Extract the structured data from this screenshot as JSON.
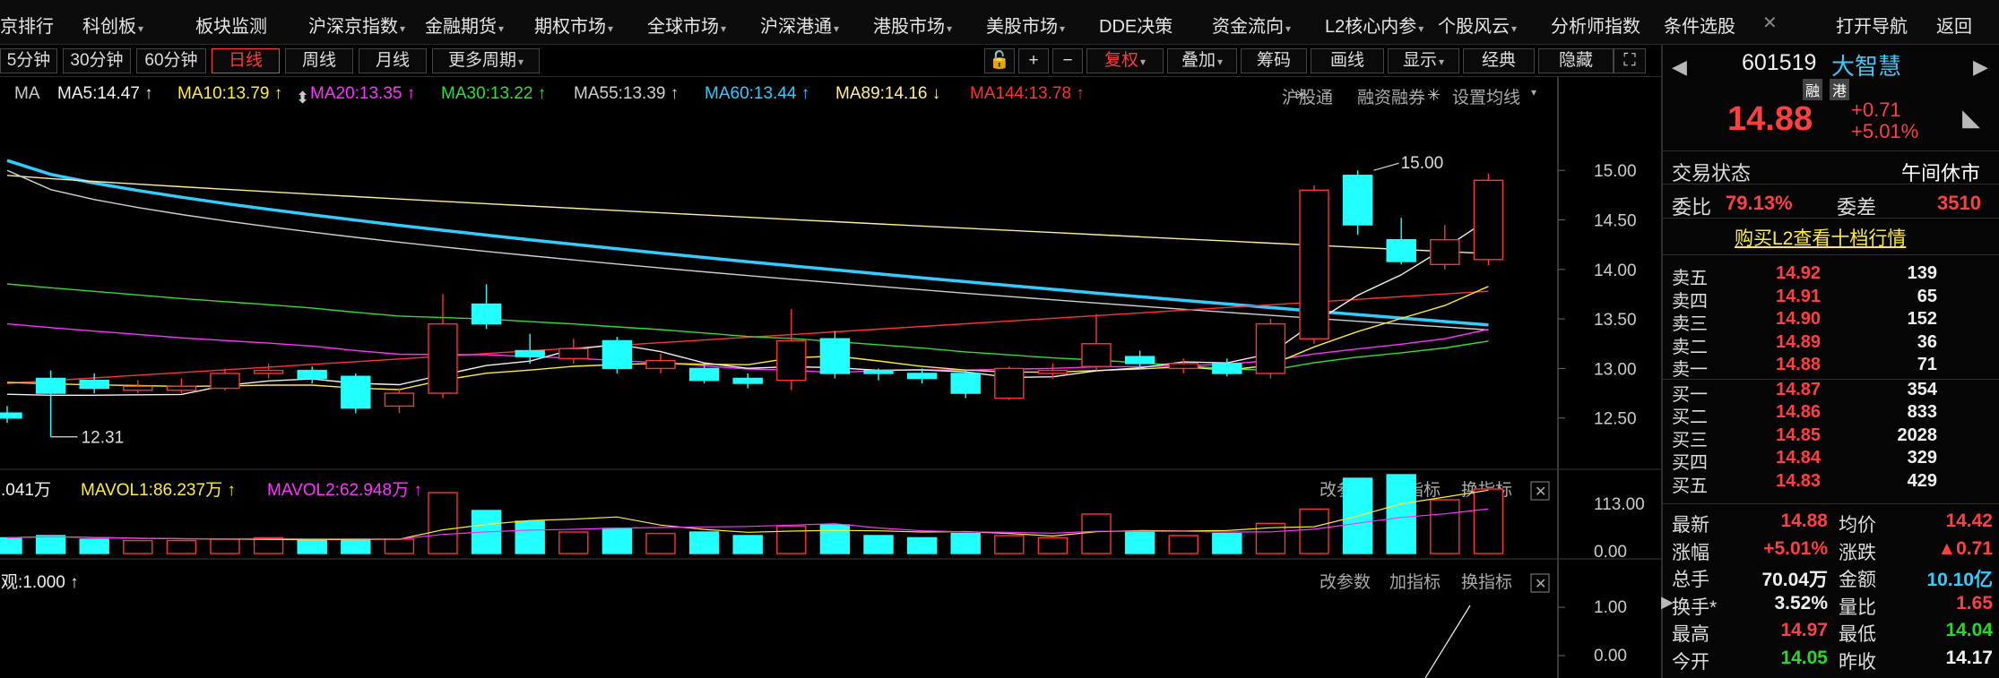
{
  "topnav": {
    "items": [
      "京排行",
      "科创板",
      "板块监测",
      "沪深京指数",
      "金融期货",
      "期权市场",
      "全球市场",
      "沪深港通",
      "港股市场",
      "美股市场",
      "DDE决策",
      "资金流向",
      "L2核心内参",
      "个股风云",
      "分析师指数",
      "条件选股"
    ],
    "right": [
      "打开导航",
      "返回"
    ]
  },
  "toolbar": {
    "periods": [
      "5分钟",
      "30分钟",
      "60分钟",
      "日线",
      "周线",
      "月线",
      "更多周期"
    ],
    "active_period": "日线",
    "tools": [
      "复权",
      "叠加",
      "筹码",
      "画线",
      "显示",
      "经典",
      "隐藏"
    ]
  },
  "ma_legend": {
    "ma_label": "MA",
    "ma5": "MA5:14.47",
    "ma10": "MA10:13.79",
    "ma20": "MA20:13.35",
    "ma30": "MA30:13.22",
    "ma55": "MA55:13.39",
    "ma60": "MA60:13.44",
    "ma89": "MA89:14.16",
    "ma144": "MA144:13.78",
    "links": [
      "沪股通",
      "融资融券",
      "设置均线"
    ]
  },
  "colors": {
    "ma5": "#f0f0f0",
    "ma10": "#ffee33",
    "ma20": "#ff33ff",
    "ma30": "#33dd33",
    "ma55": "#d0d0d0",
    "ma60": "#33ccff",
    "ma89": "#ffee99",
    "ma144": "#ff3333",
    "up": "#ff3333",
    "down": "#22ffff"
  },
  "price_axis": [
    "15.00",
    "14.50",
    "14.00",
    "13.50",
    "13.00",
    "12.50"
  ],
  "annotations": {
    "high": "15.00",
    "low": "12.31"
  },
  "volume_panel": {
    "vol_label": ".041万",
    "mavol1": "MAVOL1:86.237万",
    "mavol2": "MAVOL2:62.948万",
    "links": [
      "改参数",
      "加指标",
      "换指标"
    ],
    "axis": [
      "113.00",
      "0.00"
    ]
  },
  "indicator_panel": {
    "label": "观:1.000",
    "links": [
      "改参数",
      "加指标",
      "换指标"
    ],
    "axis": [
      "1.00",
      "0.00"
    ]
  },
  "stock": {
    "code": "601519",
    "name": "大智慧",
    "tags": [
      "融",
      "港"
    ],
    "price": "14.88",
    "change": "+0.71",
    "change_pct": "+5.01%",
    "trade_status_label": "交易状态",
    "trade_status": "午间休市",
    "weibi_label": "委比",
    "weibi": "79.13%",
    "weicha_label": "委差",
    "weicha": "3510",
    "l2_link": "购买L2查看十档行情"
  },
  "orderbook": {
    "asks": [
      {
        "label": "卖五",
        "price": "14.92",
        "vol": "139"
      },
      {
        "label": "卖四",
        "price": "14.91",
        "vol": "65"
      },
      {
        "label": "卖三",
        "price": "14.90",
        "vol": "152"
      },
      {
        "label": "卖二",
        "price": "14.89",
        "vol": "36"
      },
      {
        "label": "卖一",
        "price": "14.88",
        "vol": "71"
      }
    ],
    "bids": [
      {
        "label": "买一",
        "price": "14.87",
        "vol": "354"
      },
      {
        "label": "买二",
        "price": "14.86",
        "vol": "833"
      },
      {
        "label": "买三",
        "price": "14.85",
        "vol": "2028"
      },
      {
        "label": "买四",
        "price": "14.84",
        "vol": "329"
      },
      {
        "label": "买五",
        "price": "14.83",
        "vol": "429"
      }
    ]
  },
  "stats": {
    "left": [
      {
        "label": "最新",
        "value": "14.88",
        "color": "red"
      },
      {
        "label": "涨幅",
        "value": "+5.01%",
        "color": "red"
      },
      {
        "label": "总手",
        "value": "70.04万",
        "color": "white"
      },
      {
        "label": "换手*",
        "value": "3.52%",
        "color": "white"
      },
      {
        "label": "最高",
        "value": "14.97",
        "color": "red"
      },
      {
        "label": "今开",
        "value": "14.05",
        "color": "green"
      }
    ],
    "right": [
      {
        "label": "均价",
        "value": "14.42",
        "color": "red"
      },
      {
        "label": "涨跌",
        "value": "▲0.71",
        "color": "red"
      },
      {
        "label": "金额",
        "value": "10.10亿",
        "color": "cyan"
      },
      {
        "label": "量比",
        "value": "1.65",
        "color": "red"
      },
      {
        "label": "最低",
        "value": "14.04",
        "color": "green"
      },
      {
        "label": "昨收",
        "value": "14.17",
        "color": "white"
      }
    ]
  },
  "chart_data": {
    "type": "candlestick",
    "y_range": [
      12.0,
      15.4
    ],
    "candles": [
      {
        "o": 12.55,
        "c": 12.5,
        "h": 12.62,
        "l": 12.45
      },
      {
        "o": 12.9,
        "c": 12.75,
        "h": 12.98,
        "l": 12.31
      },
      {
        "o": 12.88,
        "c": 12.8,
        "h": 12.95,
        "l": 12.75
      },
      {
        "o": 12.78,
        "c": 12.82,
        "h": 12.88,
        "l": 12.75
      },
      {
        "o": 12.78,
        "c": 12.82,
        "h": 12.9,
        "l": 12.75
      },
      {
        "o": 12.8,
        "c": 12.95,
        "h": 13.0,
        "l": 12.78
      },
      {
        "o": 12.95,
        "c": 12.98,
        "h": 13.05,
        "l": 12.9
      },
      {
        "o": 12.98,
        "c": 12.9,
        "h": 13.02,
        "l": 12.85
      },
      {
        "o": 12.92,
        "c": 12.6,
        "h": 12.95,
        "l": 12.55
      },
      {
        "o": 12.62,
        "c": 12.75,
        "h": 12.8,
        "l": 12.55
      },
      {
        "o": 12.75,
        "c": 13.45,
        "h": 13.75,
        "l": 12.7
      },
      {
        "o": 13.65,
        "c": 13.45,
        "h": 13.85,
        "l": 13.4
      },
      {
        "o": 13.18,
        "c": 13.12,
        "h": 13.35,
        "l": 13.05
      },
      {
        "o": 13.1,
        "c": 13.2,
        "h": 13.3,
        "l": 13.05
      },
      {
        "o": 13.28,
        "c": 13.0,
        "h": 13.32,
        "l": 12.95
      },
      {
        "o": 13.0,
        "c": 13.08,
        "h": 13.15,
        "l": 12.95
      },
      {
        "o": 13.0,
        "c": 12.88,
        "h": 13.05,
        "l": 12.85
      },
      {
        "o": 12.9,
        "c": 12.85,
        "h": 12.95,
        "l": 12.8
      },
      {
        "o": 12.88,
        "c": 13.28,
        "h": 13.6,
        "l": 12.78
      },
      {
        "o": 13.3,
        "c": 12.95,
        "h": 13.38,
        "l": 12.9
      },
      {
        "o": 12.98,
        "c": 12.95,
        "h": 13.0,
        "l": 12.88
      },
      {
        "o": 12.95,
        "c": 12.9,
        "h": 13.0,
        "l": 12.85
      },
      {
        "o": 12.95,
        "c": 12.75,
        "h": 12.98,
        "l": 12.7
      },
      {
        "o": 12.7,
        "c": 13.0,
        "h": 13.02,
        "l": 12.68
      },
      {
        "o": 12.95,
        "c": 12.98,
        "h": 13.05,
        "l": 12.9
      },
      {
        "o": 13.02,
        "c": 13.25,
        "h": 13.55,
        "l": 12.98
      },
      {
        "o": 13.12,
        "c": 13.05,
        "h": 13.18,
        "l": 13.0
      },
      {
        "o": 13.0,
        "c": 13.05,
        "h": 13.1,
        "l": 12.95
      },
      {
        "o": 13.05,
        "c": 12.95,
        "h": 13.1,
        "l": 12.92
      },
      {
        "o": 12.95,
        "c": 13.45,
        "h": 13.5,
        "l": 12.9
      },
      {
        "o": 13.3,
        "c": 14.8,
        "h": 14.85,
        "l": 13.25
      },
      {
        "o": 14.95,
        "c": 14.45,
        "h": 15.0,
        "l": 14.35
      },
      {
        "o": 14.3,
        "c": 14.08,
        "h": 14.52,
        "l": 14.05
      },
      {
        "o": 14.05,
        "c": 14.3,
        "h": 14.45,
        "l": 14.0
      },
      {
        "o": 14.1,
        "c": 14.9,
        "h": 14.97,
        "l": 14.04
      }
    ],
    "volumes": [
      0.22,
      0.25,
      0.2,
      0.18,
      0.18,
      0.2,
      0.22,
      0.18,
      0.2,
      0.2,
      0.85,
      0.6,
      0.45,
      0.3,
      0.35,
      0.28,
      0.3,
      0.25,
      0.38,
      0.4,
      0.25,
      0.22,
      0.28,
      0.25,
      0.22,
      0.55,
      0.3,
      0.25,
      0.28,
      0.42,
      0.62,
      1.05,
      1.1,
      0.75,
      0.9
    ]
  }
}
